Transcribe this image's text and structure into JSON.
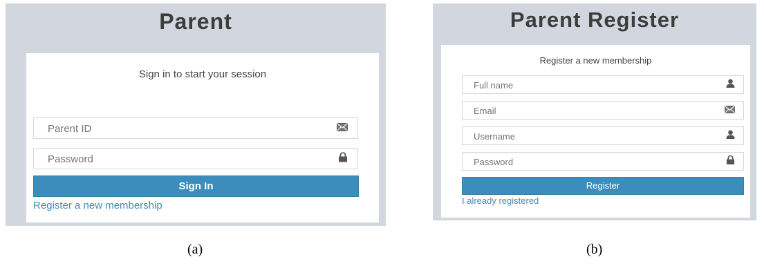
{
  "panel_a": {
    "title": "Parent",
    "message": "Sign in to start your session",
    "fields": [
      {
        "placeholder": "Parent ID",
        "icon": "envelope-icon"
      },
      {
        "placeholder": "Password",
        "icon": "lock-icon"
      }
    ],
    "button_label": "Sign In",
    "link_text": "Register a new membership"
  },
  "panel_b": {
    "title": "Parent Register",
    "message": "Register a new membership",
    "fields": [
      {
        "placeholder": "Full name",
        "icon": "user-icon"
      },
      {
        "placeholder": "Email",
        "icon": "envelope-icon"
      },
      {
        "placeholder": "Username",
        "icon": "user-icon"
      },
      {
        "placeholder": "Password",
        "icon": "lock-icon"
      }
    ],
    "button_label": "Register",
    "link_text": "I already registered"
  },
  "captions": {
    "a": "(a)",
    "b": "(b)"
  },
  "colors": {
    "background": "#d2d6de",
    "primary": "#3c8dbc",
    "border": "#d2d6de"
  }
}
